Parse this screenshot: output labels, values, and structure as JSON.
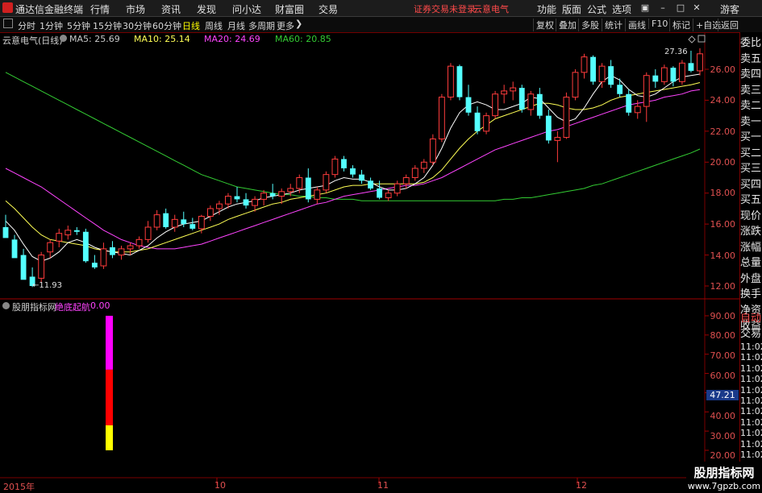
{
  "app": {
    "title": "通达信金融终端",
    "menus": [
      "行情",
      "市场",
      "资讯",
      "发现",
      "问小达",
      "财富圈",
      "交易"
    ],
    "notice": "证券交易未登录",
    "stock_name_top": "云意电气",
    "right_menus": [
      "功能",
      "版面",
      "公式",
      "选项"
    ],
    "visitor": "游客"
  },
  "toolbar": {
    "periods": [
      "分时",
      "1分钟",
      "5分钟",
      "15分钟",
      "30分钟",
      "60分钟",
      "日线",
      "周线",
      "月线",
      "多周期",
      "更多"
    ],
    "active": "日线",
    "right": [
      "复权",
      "叠加",
      "多股",
      "统计",
      "画线",
      "F10",
      "标记",
      "+自选",
      "返回"
    ]
  },
  "main_chart": {
    "title": "云意电气(日线)",
    "ma": [
      {
        "label": "MA5: 25.69",
        "color": "#ffffff"
      },
      {
        "label": "MA10: 25.14",
        "color": "#ffff55"
      },
      {
        "label": "MA20: 24.69",
        "color": "#ff44ff"
      },
      {
        "label": "MA60: 20.85",
        "color": "#33cc33"
      }
    ],
    "high_label": "27.36",
    "low_label": "11.93",
    "y_ticks": [
      "26.00",
      "24.00",
      "22.00",
      "20.00",
      "18.00",
      "16.00",
      "14.00",
      "12.00"
    ]
  },
  "indicator": {
    "name": "股朋指标网",
    "line_name": "绝底起航",
    "value": "0.00",
    "y_ticks": [
      "90.00",
      "80.00",
      "70.00",
      "60.00",
      "50.00",
      "40.00",
      "30.00",
      "20.00"
    ],
    "current": "47.21"
  },
  "x_labels": [
    "2015年",
    "10",
    "11",
    "12"
  ],
  "right_panel": {
    "items": [
      "委比",
      "卖五",
      "卖四",
      "卖三",
      "卖二",
      "卖一",
      "买一",
      "买二",
      "买三",
      "买四",
      "买五",
      "现价",
      "涨跌",
      "涨幅",
      "总量",
      "外盘",
      "换手",
      "净资",
      "收益"
    ],
    "lower": [
      "自动",
      "交易",
      "11:02",
      "11:02",
      "11:02",
      "11:02",
      "11:02",
      "11:02",
      "11:02",
      "11:02",
      "11:02",
      "11:02",
      "11:02",
      "11:02",
      "11:02",
      "11:0"
    ]
  },
  "chart_data": {
    "type": "candlestick",
    "ylim": [
      11,
      28
    ],
    "candles": [
      [
        15.8,
        16.6,
        15.4,
        15.1
      ],
      [
        15.0,
        15.3,
        14.0,
        13.8
      ],
      [
        14.0,
        14.4,
        12.8,
        12.4
      ],
      [
        12.6,
        13.2,
        11.93,
        12.0
      ],
      [
        12.5,
        14.2,
        12.2,
        14.0
      ],
      [
        14.2,
        15.0,
        13.8,
        14.8
      ],
      [
        14.9,
        15.7,
        14.5,
        15.4
      ],
      [
        15.3,
        15.9,
        15.0,
        15.6
      ],
      [
        15.6,
        15.8,
        15.3,
        15.5
      ],
      [
        15.5,
        15.7,
        13.5,
        13.6
      ],
      [
        13.5,
        14.0,
        13.1,
        13.2
      ],
      [
        13.3,
        14.8,
        13.1,
        14.4
      ],
      [
        14.5,
        14.9,
        13.8,
        14.0
      ],
      [
        14.0,
        14.6,
        13.7,
        14.4
      ],
      [
        14.4,
        14.8,
        14.0,
        14.6
      ],
      [
        14.6,
        15.2,
        14.4,
        15.0
      ],
      [
        15.0,
        16.2,
        14.8,
        15.8
      ],
      [
        15.8,
        16.9,
        15.6,
        16.6
      ],
      [
        16.7,
        17.0,
        15.7,
        15.8
      ],
      [
        15.8,
        16.6,
        15.5,
        16.3
      ],
      [
        16.3,
        16.8,
        15.8,
        16.0
      ],
      [
        16.0,
        16.4,
        15.6,
        15.7
      ],
      [
        15.7,
        16.6,
        15.4,
        16.5
      ],
      [
        16.5,
        17.2,
        16.2,
        17.0
      ],
      [
        17.0,
        17.5,
        16.6,
        17.3
      ],
      [
        17.3,
        18.0,
        17.0,
        17.8
      ],
      [
        17.8,
        18.4,
        17.4,
        17.6
      ],
      [
        17.6,
        18.0,
        17.0,
        17.2
      ],
      [
        17.2,
        17.8,
        16.8,
        17.6
      ],
      [
        17.6,
        18.2,
        17.2,
        18.0
      ],
      [
        18.0,
        18.6,
        17.6,
        17.8
      ],
      [
        17.8,
        18.3,
        17.3,
        18.1
      ],
      [
        18.1,
        18.6,
        17.8,
        18.3
      ],
      [
        18.3,
        19.2,
        18.0,
        19.0
      ],
      [
        19.0,
        19.6,
        17.4,
        17.6
      ],
      [
        17.6,
        18.4,
        17.3,
        18.2
      ],
      [
        18.2,
        19.4,
        18.0,
        19.2
      ],
      [
        19.2,
        20.4,
        19.0,
        20.2
      ],
      [
        20.2,
        20.4,
        19.4,
        19.6
      ],
      [
        19.6,
        19.8,
        19.0,
        19.2
      ],
      [
        19.2,
        19.5,
        18.6,
        18.8
      ],
      [
        18.8,
        19.0,
        18.2,
        18.3
      ],
      [
        18.3,
        18.8,
        17.6,
        17.7
      ],
      [
        17.7,
        18.2,
        17.5,
        18.0
      ],
      [
        18.0,
        18.8,
        17.8,
        18.6
      ],
      [
        18.6,
        19.2,
        18.3,
        19.0
      ],
      [
        19.0,
        19.8,
        18.8,
        19.6
      ],
      [
        19.6,
        20.2,
        19.3,
        20.0
      ],
      [
        20.0,
        21.8,
        19.8,
        21.5
      ],
      [
        21.5,
        24.4,
        21.3,
        24.2
      ],
      [
        24.2,
        26.4,
        24.0,
        26.2
      ],
      [
        26.2,
        26.3,
        24.0,
        24.2
      ],
      [
        24.2,
        25.0,
        23.0,
        23.2
      ],
      [
        23.2,
        23.6,
        21.8,
        22.0
      ],
      [
        22.0,
        23.2,
        21.8,
        23.0
      ],
      [
        23.0,
        24.6,
        22.8,
        24.4
      ],
      [
        24.4,
        25.0,
        23.8,
        24.6
      ],
      [
        24.6,
        25.2,
        24.0,
        24.8
      ],
      [
        24.8,
        25.0,
        23.2,
        23.4
      ],
      [
        23.4,
        24.6,
        23.0,
        24.4
      ],
      [
        24.4,
        24.8,
        22.8,
        23.0
      ],
      [
        23.0,
        23.4,
        21.2,
        21.4
      ],
      [
        21.4,
        22.0,
        20.0,
        21.6
      ],
      [
        21.6,
        24.5,
        21.5,
        24.2
      ],
      [
        24.2,
        26.0,
        24.0,
        25.8
      ],
      [
        25.8,
        27.0,
        25.4,
        26.8
      ],
      [
        26.8,
        26.9,
        25.0,
        25.2
      ],
      [
        25.2,
        26.4,
        24.8,
        26.2
      ],
      [
        26.2,
        26.6,
        24.8,
        25.0
      ],
      [
        25.0,
        25.4,
        24.2,
        24.4
      ],
      [
        24.4,
        24.7,
        23.0,
        23.2
      ],
      [
        23.2,
        24.0,
        22.8,
        23.6
      ],
      [
        23.6,
        25.8,
        22.6,
        25.6
      ],
      [
        25.6,
        26.0,
        24.8,
        25.2
      ],
      [
        25.2,
        26.3,
        25.0,
        26.1
      ],
      [
        26.1,
        26.2,
        24.9,
        25.2
      ],
      [
        25.2,
        26.6,
        25.0,
        26.4
      ],
      [
        26.4,
        27.2,
        25.8,
        25.9
      ],
      [
        25.9,
        27.36,
        25.6,
        27.0
      ]
    ],
    "ma5": [
      16.2,
      15.6,
      14.7,
      13.9,
      13.6,
      13.8,
      14.2,
      14.8,
      15.0,
      14.8,
      14.5,
      14.3,
      14.2,
      14.1,
      14.0,
      14.3,
      14.6,
      15.1,
      15.5,
      15.8,
      16.0,
      16.1,
      16.2,
      16.5,
      16.8,
      17.1,
      17.3,
      17.4,
      17.5,
      17.7,
      17.8,
      17.9,
      18.0,
      18.2,
      18.3,
      18.4,
      18.5,
      18.8,
      19.0,
      18.9,
      18.9,
      18.7,
      18.4,
      18.2,
      18.2,
      18.3,
      18.6,
      19.0,
      19.8,
      20.9,
      22.2,
      23.2,
      23.7,
      23.9,
      23.7,
      23.4,
      23.4,
      23.6,
      23.8,
      24.2,
      24.1,
      23.5,
      22.9,
      22.6,
      22.8,
      23.5,
      24.4,
      25.2,
      25.6,
      25.3,
      24.7,
      24.3,
      24.2,
      24.4,
      24.8,
      25.2,
      25.5,
      25.6,
      25.69
    ],
    "ma10": [
      17.5,
      17.0,
      16.4,
      15.8,
      15.3,
      15.0,
      14.9,
      14.8,
      14.7,
      14.6,
      14.4,
      14.3,
      14.2,
      14.2,
      14.2,
      14.3,
      14.4,
      14.6,
      14.8,
      15.0,
      15.2,
      15.4,
      15.6,
      15.8,
      16.0,
      16.3,
      16.5,
      16.7,
      16.9,
      17.1,
      17.3,
      17.4,
      17.6,
      17.7,
      17.8,
      17.9,
      18.0,
      18.2,
      18.4,
      18.5,
      18.5,
      18.6,
      18.6,
      18.6,
      18.6,
      18.6,
      18.6,
      18.7,
      19.0,
      19.5,
      20.2,
      20.9,
      21.5,
      22.0,
      22.4,
      22.8,
      23.0,
      23.2,
      23.4,
      23.6,
      23.8,
      23.8,
      23.7,
      23.5,
      23.4,
      23.4,
      23.5,
      23.7,
      24.0,
      24.2,
      24.3,
      24.4,
      24.5,
      24.6,
      24.7,
      24.8,
      24.9,
      25.0,
      25.14
    ],
    "ma20": [
      19.6,
      19.3,
      19.0,
      18.7,
      18.4,
      18.0,
      17.6,
      17.2,
      16.8,
      16.4,
      16.0,
      15.6,
      15.3,
      15.0,
      14.8,
      14.6,
      14.5,
      14.4,
      14.4,
      14.4,
      14.5,
      14.6,
      14.7,
      14.9,
      15.1,
      15.3,
      15.5,
      15.7,
      15.9,
      16.1,
      16.3,
      16.5,
      16.7,
      16.9,
      17.1,
      17.3,
      17.4,
      17.6,
      17.8,
      17.9,
      18.0,
      18.1,
      18.2,
      18.3,
      18.4,
      18.5,
      18.5,
      18.6,
      18.8,
      19.0,
      19.3,
      19.6,
      19.9,
      20.2,
      20.5,
      20.8,
      21.0,
      21.2,
      21.4,
      21.6,
      21.8,
      22.0,
      22.1,
      22.3,
      22.5,
      22.7,
      22.9,
      23.1,
      23.3,
      23.5,
      23.7,
      23.8,
      23.9,
      24.0,
      24.2,
      24.3,
      24.4,
      24.6,
      24.69
    ],
    "ma60": [
      25.8,
      25.5,
      25.2,
      24.9,
      24.6,
      24.3,
      24.0,
      23.7,
      23.4,
      23.1,
      22.8,
      22.5,
      22.2,
      21.9,
      21.6,
      21.3,
      21.0,
      20.7,
      20.4,
      20.1,
      19.8,
      19.5,
      19.2,
      19.0,
      18.8,
      18.6,
      18.4,
      18.3,
      18.2,
      18.1,
      18.0,
      17.9,
      17.9,
      17.8,
      17.8,
      17.7,
      17.7,
      17.6,
      17.6,
      17.6,
      17.5,
      17.5,
      17.5,
      17.5,
      17.5,
      17.5,
      17.5,
      17.5,
      17.5,
      17.5,
      17.5,
      17.5,
      17.5,
      17.5,
      17.5,
      17.5,
      17.6,
      17.6,
      17.7,
      17.7,
      17.8,
      17.9,
      18.0,
      18.1,
      18.2,
      18.3,
      18.5,
      18.6,
      18.8,
      19.0,
      19.2,
      19.4,
      19.6,
      19.8,
      20.0,
      20.2,
      20.4,
      20.6,
      20.85
    ],
    "indicator_bars": [
      {
        "from": 20,
        "to": 33,
        "color": "#ffff00"
      },
      {
        "from": 33,
        "to": 62,
        "color": "#ff0000"
      },
      {
        "from": 62,
        "to": 90,
        "color": "#ff00ff"
      }
    ]
  }
}
